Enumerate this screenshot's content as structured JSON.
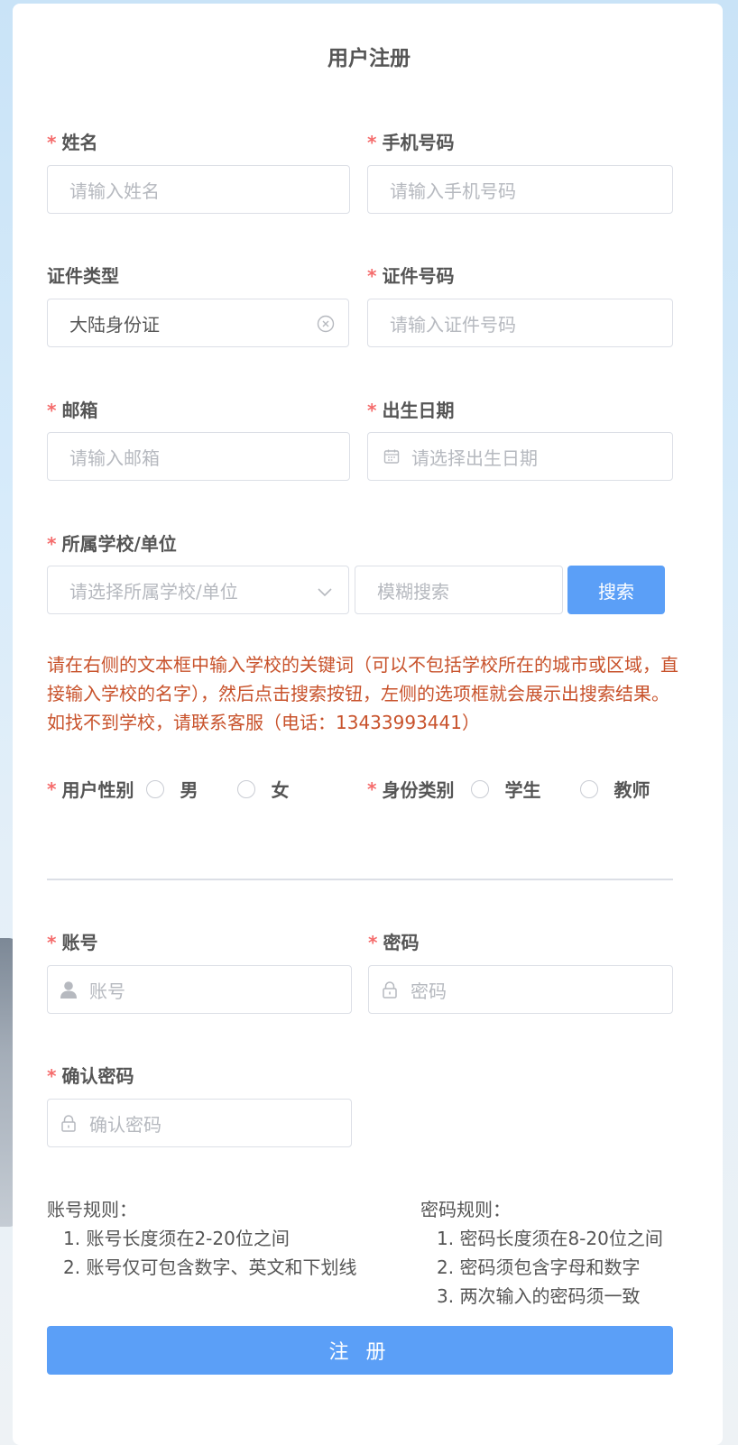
{
  "title": "用户注册",
  "required_mark": "*",
  "name": {
    "label": "姓名",
    "placeholder": "请输入姓名"
  },
  "phone": {
    "label": "手机号码",
    "placeholder": "请输入手机号码"
  },
  "id_type": {
    "label": "证件类型",
    "value": "大陆身份证"
  },
  "id_number": {
    "label": "证件号码",
    "placeholder": "请输入证件号码"
  },
  "email": {
    "label": "邮箱",
    "placeholder": "请输入邮箱"
  },
  "birth": {
    "label": "出生日期",
    "placeholder": "请选择出生日期"
  },
  "school": {
    "label": "所属学校/单位",
    "select_placeholder": "请选择所属学校/单位",
    "search_placeholder": "模糊搜索",
    "search_button": "搜索"
  },
  "hint": {
    "line1": "请在右侧的文本框中输入学校的关键词（可以不包括学校所在的城市或区域，直接输入学校的名字），然后点击搜索按钮，左侧的选项框就会展示出搜索结果。",
    "line2": "如找不到学校，请联系客服（电话：13433993441）"
  },
  "gender": {
    "label": "用户性别",
    "options": [
      "男",
      "女"
    ]
  },
  "identity": {
    "label": "身份类别",
    "options": [
      "学生",
      "教师"
    ]
  },
  "account": {
    "label": "账号",
    "placeholder": "账号"
  },
  "password": {
    "label": "密码",
    "placeholder": "密码"
  },
  "confirm": {
    "label": "确认密码",
    "placeholder": "确认密码"
  },
  "account_rules": {
    "title": "账号规则：",
    "items": [
      "1. 账号长度须在2-20位之间",
      "2. 账号仅可包含数字、英文和下划线"
    ]
  },
  "password_rules": {
    "title": "密码规则：",
    "items": [
      "1. 密码长度须在8-20位之间",
      "2. 密码须包含字母和数字",
      "3. 两次输入的密码须一致"
    ]
  },
  "submit": "注 册"
}
